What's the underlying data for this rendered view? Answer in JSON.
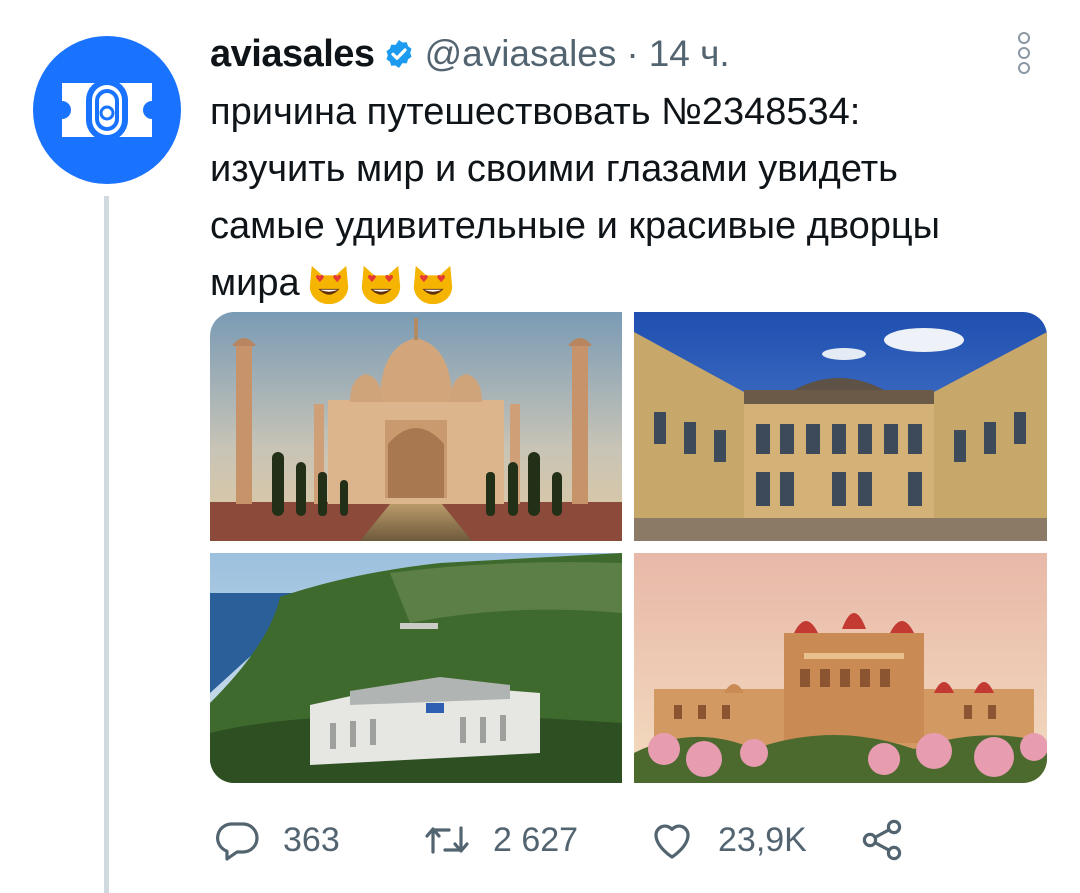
{
  "author": {
    "display_name": "aviasales",
    "handle": "@aviasales",
    "time_separator": "·",
    "time": "14 ч."
  },
  "tweet": {
    "text": "причина путешествовать №2348534:\nизучить мир и своими глазами увидеть\nсамые удивительные и красивые дворцы\nмира",
    "emojis": [
      "smiling-cat-heart-eyes",
      "smiling-cat-heart-eyes",
      "smiling-cat-heart-eyes"
    ]
  },
  "media": [
    {
      "icon": "taj-mahal-photo"
    },
    {
      "icon": "versailles-palace-photo"
    },
    {
      "icon": "seaside-palace-photo"
    },
    {
      "icon": "mysore-palace-photo"
    }
  ],
  "actions": {
    "replies": "363",
    "retweets": "2 627",
    "likes": "23,9K"
  },
  "colors": {
    "accent": "#1d9bf0",
    "avatar_bg": "#1a73ff",
    "secondary_text": "#536471",
    "thread_line": "#cfd9de"
  }
}
